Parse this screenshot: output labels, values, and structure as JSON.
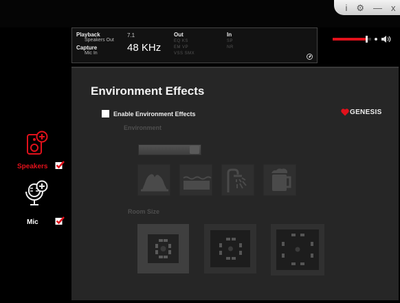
{
  "window": {
    "controls": {
      "info": "i",
      "settings": "⚙",
      "minimize": "—",
      "close": "x"
    }
  },
  "info": {
    "playback_label": "Playback",
    "playback_device": "Speakers Out",
    "capture_label": "Capture",
    "capture_device": "Mic In",
    "channels": "7.1",
    "sample_rate": "48 KHz",
    "out_label": "Out",
    "out_row1": "EQ   KS",
    "out_row2": "EM   VP",
    "out_row3": "VSS  SMX",
    "in_label": "In",
    "in_row1": "SP",
    "in_row2": "NR"
  },
  "volume": {
    "level": 0.88
  },
  "sidebar": {
    "items": [
      {
        "label": "Speakers",
        "checked": true,
        "active": true
      },
      {
        "label": "Mic",
        "checked": true,
        "active": false
      }
    ]
  },
  "main": {
    "title": "Environment Effects",
    "enable_label": "Enable Environment Effects",
    "enable_checked": true,
    "brand": "GENESIS",
    "environment_label": "Environment",
    "environment_value": "",
    "environment_presets": [
      "theater-icon",
      "water-icon",
      "shower-icon",
      "beer-icon"
    ],
    "room_size_label": "Room Size",
    "room_sizes": [
      "small-room-icon",
      "medium-room-icon",
      "large-room-icon"
    ]
  },
  "colors": {
    "accent": "#e2111b",
    "panel": "#262626",
    "background": "#000000"
  }
}
